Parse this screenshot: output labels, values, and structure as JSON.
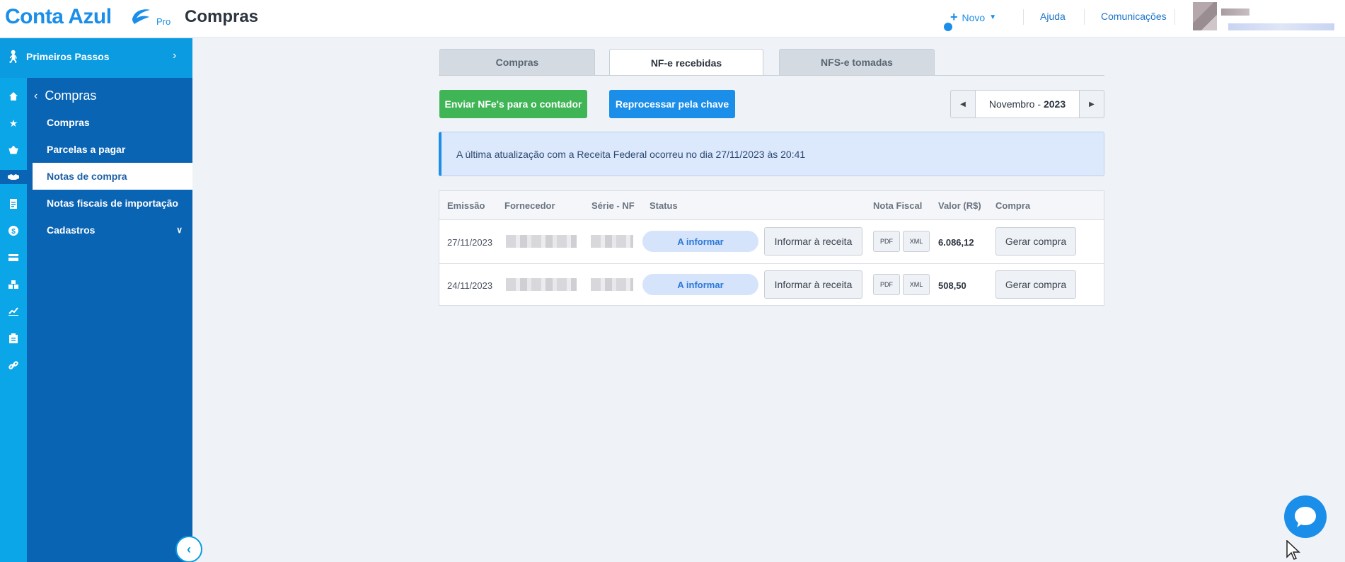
{
  "app": {
    "logo": "Conta Azul",
    "logo_pro": "Pro",
    "page_title": "Compras"
  },
  "header": {
    "novo": "Novo",
    "ajuda": "Ajuda",
    "comunicacoes": "Comunicações"
  },
  "sidebar": {
    "primeiros_passos": "Primeiros Passos",
    "section_title": "Compras",
    "items": [
      {
        "label": "Compras"
      },
      {
        "label": "Parcelas a pagar"
      },
      {
        "label": "Notas de compra"
      },
      {
        "label": "Notas fiscais de importação"
      },
      {
        "label": "Cadastros"
      }
    ]
  },
  "tabs": [
    {
      "label": "Compras"
    },
    {
      "label": "NF-e recebidas"
    },
    {
      "label": "NFS-e tomadas"
    }
  ],
  "actions": {
    "send": "Enviar NFe's para o contador",
    "reprocess": "Reprocessar pela chave",
    "month": "Novembro -",
    "year": "2023"
  },
  "info": {
    "text": "A última atualização com a Receita Federal ocorreu no dia 27/11/2023 às 20:41"
  },
  "table": {
    "columns": [
      "Emissão",
      "Fornecedor",
      "Série - NF",
      "Status",
      "Nota Fiscal",
      "Valor (R$)",
      "Compra"
    ],
    "rows": [
      {
        "emissao": "27/11/2023",
        "status": "A informar",
        "informar": "Informar à receita",
        "pdf": "PDF",
        "xml": "XML",
        "valor": "6.086,12",
        "gerar": "Gerar compra"
      },
      {
        "emissao": "24/11/2023",
        "status": "A informar",
        "informar": "Informar à receita",
        "pdf": "PDF",
        "xml": "XML",
        "valor": "508,50",
        "gerar": "Gerar compra"
      }
    ]
  },
  "colors": {
    "brand": "#1a8ee8",
    "sidebar": "#0a64b4",
    "rail": "#0aa6e8",
    "green": "#3fb555"
  }
}
